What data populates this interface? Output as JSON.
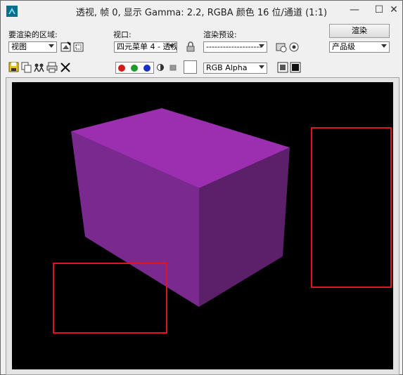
{
  "window": {
    "title": "透视, 帧 0, 显示 Gamma: 2.2, RGBA 颜色 16 位/通道 (1:1)",
    "minimize_glyph": "—",
    "maximize_glyph": "☐",
    "close_glyph": "✕"
  },
  "toolbar": {
    "area_label": "要渲染的区域:",
    "area_value": "视图",
    "viewport_label": "视口:",
    "viewport_value": "四元菜单 4 - 透视",
    "preset_label": "渲染预设:",
    "preset_value": "--------------------",
    "render_button": "渲染",
    "quality_value": "产品级",
    "channel_value": "RGB Alpha"
  },
  "colors": {
    "channel_red": "#d41b1b",
    "channel_green": "#1c9a2a",
    "channel_blue": "#1a2fc7",
    "cube_top": "#9b2fb0",
    "cube_left": "#7a2a8f",
    "cube_front": "#5c1f6a",
    "highlight_box": "#e0141e",
    "viewport_bg": "#000000"
  },
  "icons": {
    "app": "3dsmax-icon",
    "area_edit": "edit-region-icon",
    "area_auto": "auto-region-icon",
    "lock": "lock-icon",
    "preset_env": "environment-icon",
    "preset_effect": "effects-icon",
    "save": "save-icon",
    "copy": "copy-image-icon",
    "clone": "clone-frame-buffer-icon",
    "print": "print-icon",
    "clear": "clear-icon",
    "mono": "monochrome-icon",
    "swatch": "color-swatch-icon",
    "alpha_view": "alpha-display-icon",
    "display_mode": "display-mode-icon"
  }
}
